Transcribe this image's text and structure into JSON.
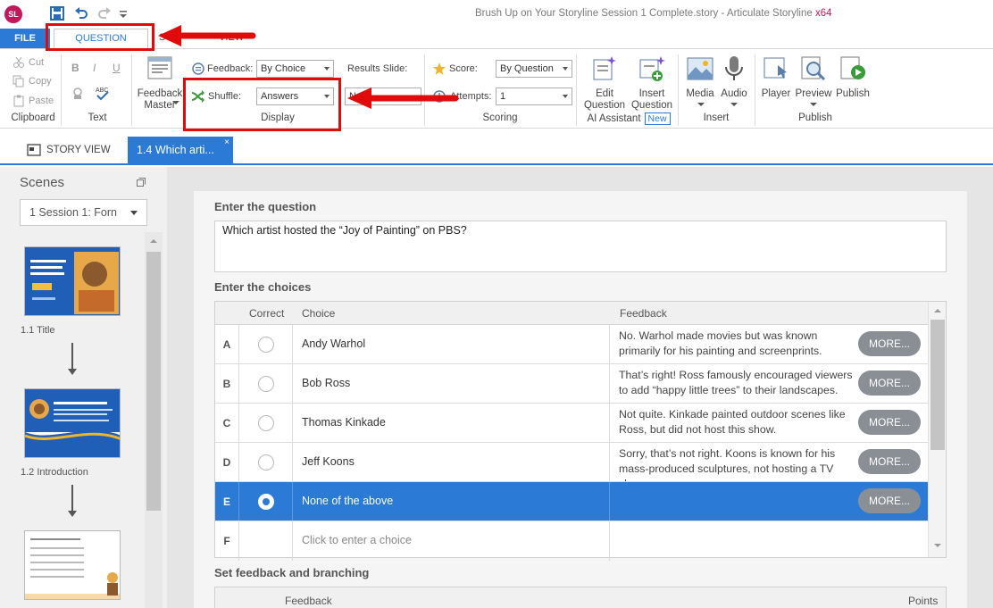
{
  "user_initials": "SL",
  "window_title": "Brush Up on Your Storyline Session 1 Complete.story - Articulate Storyline",
  "window_arch": "x64",
  "ribbon_tabs": {
    "file": "FILE",
    "question": "QUESTION",
    "hidden_1": "S",
    "hidden_2": "VIEW"
  },
  "clipboard": {
    "cut": "Cut",
    "copy": "Copy",
    "paste": "Paste",
    "label": "Clipboard"
  },
  "text_group": {
    "bold": "B",
    "italic": "I",
    "underline": "U",
    "label": "Text"
  },
  "feedback_master": {
    "line1": "Feedback",
    "line2": "Master"
  },
  "display": {
    "feedback_label": "Feedback:",
    "feedback_value": "By Choice",
    "shuffle_label": "Shuffle:",
    "shuffle_value": "Answers",
    "results_slide_label": "Results Slide:",
    "results_slide_value": "No",
    "label": "Display"
  },
  "scoring": {
    "score_label": "Score:",
    "score_value": "By Question",
    "attempts_label": "Attempts:",
    "attempts_value": "1",
    "label": "Scoring"
  },
  "ai_assistant": {
    "edit_line1": "Edit",
    "edit_line2": "Question",
    "insert_line1": "Insert",
    "insert_line2": "Question",
    "label": "AI Assistant",
    "badge": "New"
  },
  "insert_group": {
    "media": "Media",
    "audio": "Audio",
    "label": "Insert"
  },
  "publish_group": {
    "player": "Player",
    "preview": "Preview",
    "publish": "Publish",
    "label": "Publish"
  },
  "doc_tabs": {
    "story_view": "STORY VIEW",
    "active_slide": "1.4 Which arti...",
    "close": "×"
  },
  "scenes_panel": {
    "title": "Scenes",
    "scene_select": "1 Session 1: Forn",
    "slides": [
      {
        "label": "1.1 Title"
      },
      {
        "label": "1.2 Introduction"
      },
      {
        "label": ""
      }
    ]
  },
  "question_section": {
    "title": "Enter the question",
    "text": "Which artist hosted the “Joy of Painting” on PBS?"
  },
  "choices_section": {
    "title": "Enter the choices",
    "headers": {
      "correct": "Correct",
      "choice": "Choice",
      "feedback": "Feedback"
    },
    "more_label": "MORE...",
    "rows": [
      {
        "letter": "A",
        "choice": "Andy Warhol",
        "feedback": "No. Warhol made movies but was known primarily for his painting and screenprints.",
        "correct": false
      },
      {
        "letter": "B",
        "choice": "Bob Ross",
        "feedback": "That’s right! Ross famously encouraged viewers to add “happy little trees” to their landscapes.",
        "correct": false
      },
      {
        "letter": "C",
        "choice": "Thomas Kinkade",
        "feedback": "Not quite. Kinkade painted outdoor scenes like Ross, but did not host this show.",
        "correct": false
      },
      {
        "letter": "D",
        "choice": "Jeff Koons",
        "feedback": "Sorry, that’s not right. Koons is known for his mass-produced sculptures, not hosting a TV show.",
        "correct": false
      },
      {
        "letter": "E",
        "choice": "None of the above",
        "feedback": "",
        "correct": true
      },
      {
        "letter": "F",
        "choice": "Click to enter a choice",
        "feedback": "",
        "correct": false
      }
    ]
  },
  "feedback_section": {
    "title": "Set feedback and branching",
    "headers": {
      "feedback": "Feedback",
      "points": "Points"
    }
  },
  "colors": {
    "accent": "#2b7bd6",
    "annotation": "#e00b0b",
    "avatar": "#c2185b"
  }
}
